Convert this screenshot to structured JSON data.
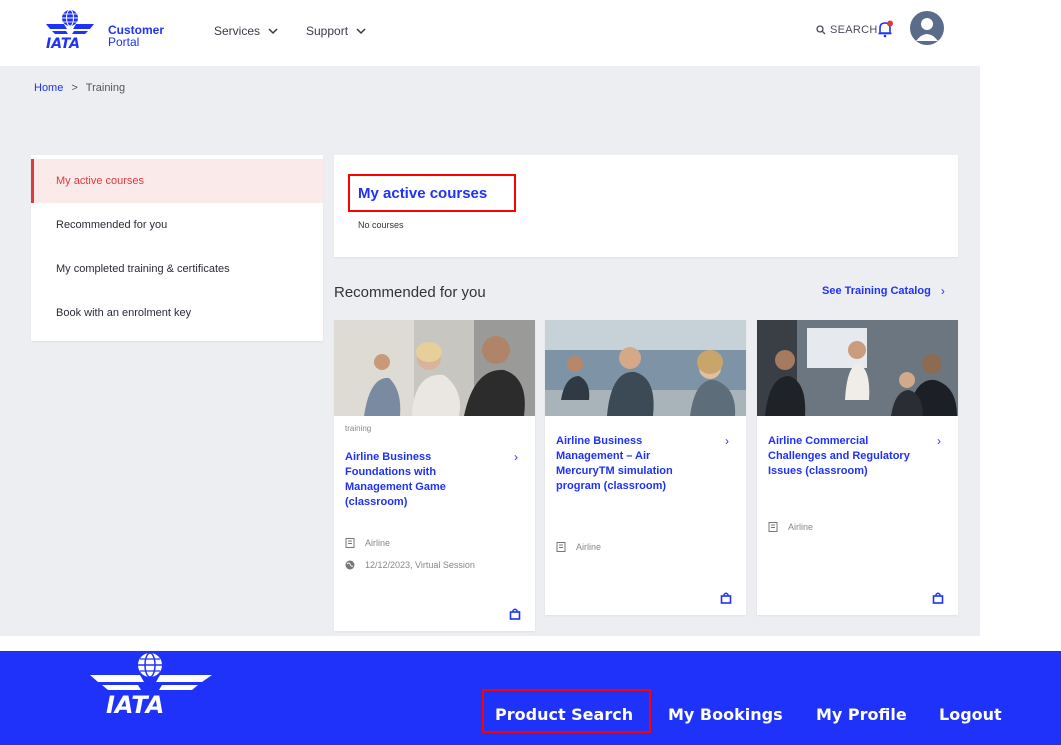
{
  "header": {
    "portal_line1": "Customer",
    "portal_line2": "Portal",
    "nav": [
      {
        "label": "Services"
      },
      {
        "label": "Support"
      }
    ],
    "search_label": "SEARCH"
  },
  "breadcrumb": {
    "home": "Home",
    "separator": ">",
    "current": "Training"
  },
  "sidebar": {
    "items": [
      {
        "label": "My active courses",
        "active": true
      },
      {
        "label": "Recommended for you",
        "active": false
      },
      {
        "label": "My completed training & certificates",
        "active": false
      },
      {
        "label": "Book with an enrolment key",
        "active": false
      }
    ]
  },
  "active_courses": {
    "title": "My active courses",
    "empty_text": "No courses"
  },
  "recommended": {
    "title": "Recommended for you",
    "catalog_link": "See Training Catalog",
    "cards": [
      {
        "tag": "training",
        "title": "Airline Business Foundations with Management Game (classroom)",
        "audience": "Airline",
        "session": "12/12/2023, Virtual Session"
      },
      {
        "tag": "",
        "title": "Airline Business Management – Air MercuryTM simulation program (classroom)",
        "audience": "Airline",
        "session": ""
      },
      {
        "tag": "",
        "title": "Airline Commercial Challenges and Regulatory Issues (classroom)",
        "audience": "Airline",
        "session": ""
      }
    ]
  },
  "bottom_bar": {
    "logo_text": "IATA",
    "nav": [
      {
        "label": "Product Search"
      },
      {
        "label": "My Bookings"
      },
      {
        "label": "My Profile"
      },
      {
        "label": "Logout"
      }
    ]
  },
  "colors": {
    "brand_blue": "#1e32fa",
    "accent_red": "#e03a3a",
    "highlight": "#ff0000",
    "background_grey": "#edeef2"
  }
}
